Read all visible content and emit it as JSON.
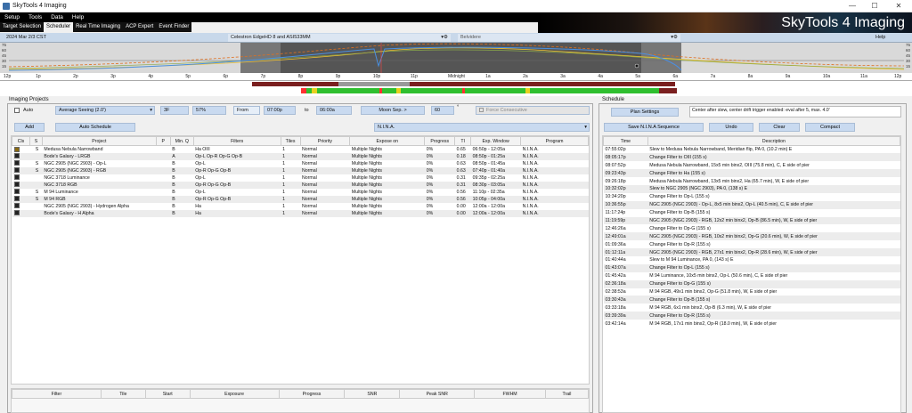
{
  "window": {
    "title": "SkyTools 4 Imaging",
    "minimize": "—",
    "maximize": "☐",
    "close": "✕"
  },
  "menu": [
    "Setup",
    "Tools",
    "Data",
    "Help"
  ],
  "banner": "SkyTools 4 Imaging",
  "tabs": [
    {
      "label": "Target Selection",
      "active": false
    },
    {
      "label": "Scheduler",
      "active": true
    },
    {
      "label": "Real Time Imaging",
      "active": false
    },
    {
      "label": "ACP Expert",
      "active": false
    },
    {
      "label": "Event Finder",
      "active": false
    }
  ],
  "context": {
    "date": "2024 Mar 2/3 CST",
    "scope": "Celestron EdgeHD 8 and ASI533MM",
    "site": "Belvidere",
    "help": "Help"
  },
  "chart": {
    "ylabels": [
      "75",
      "60",
      "45",
      "30",
      "15"
    ],
    "time_labels": [
      "12p",
      "1p",
      "2p",
      "3p",
      "4p",
      "5p",
      "6p",
      "7p",
      "8p",
      "9p",
      "10p",
      "11p",
      "Midnight",
      "1a",
      "2a",
      "3a",
      "4a",
      "5a",
      "6a",
      "7a",
      "8a",
      "9a",
      "10a",
      "11a",
      "12p"
    ]
  },
  "projects_panel": {
    "group_label": "Imaging Projects",
    "auto_label": "Auto",
    "seeing": "Average Seeing (2.0')",
    "pct_a": "3F",
    "pct_b": "57%",
    "from_label": "From",
    "from": "07:00p",
    "to_label": "to",
    "to": "06:00a",
    "moon_label": "Moon Sep. >",
    "moon_sep": "60",
    "deg": "°",
    "force_label": "Force Consecutive",
    "add": "Add",
    "auto_schedule": "Auto Schedule",
    "program": "N.I.N.A.",
    "columns": [
      "Cls",
      "S",
      "Project",
      "P",
      "Min. Q",
      "Filters",
      "Tiles",
      "Priority",
      "Expose on",
      "Progress",
      "TI",
      "Exp. Window",
      "Program"
    ],
    "rows": [
      [
        "S",
        "Medusa Nebula Narrowband",
        "",
        "B",
        "Ha OIII",
        "1",
        "Normal",
        "Multiple Nights",
        "0%",
        "0.65",
        "06:50p - 12:05a",
        "N.I.N.A."
      ],
      [
        "",
        "Bode's Galaxy - LRGB",
        "",
        "A",
        "Op-L Op-R Op-G Op-B",
        "1",
        "Normal",
        "Multiple Nights",
        "0%",
        "0.18",
        "08:50p - 01:25a",
        "N.I.N.A."
      ],
      [
        "S",
        "NGC 2905 (NGC 2903) - Op-L",
        "",
        "B",
        "Op-L",
        "1",
        "Normal",
        "Multiple Nights",
        "0%",
        "0.63",
        "08:50p - 01:45a",
        "N.I.N.A."
      ],
      [
        "S",
        "NGC 2905 (NGC 2903) - RGB",
        "",
        "B",
        "Op-R Op-G Op-B",
        "1",
        "Normal",
        "Multiple Nights",
        "0%",
        "0.63",
        "07:40p - 01:40a",
        "N.I.N.A."
      ],
      [
        "",
        "NGC 3718 Luminance",
        "",
        "B",
        "Op-L",
        "1",
        "Normal",
        "Multiple Nights",
        "0%",
        "0.31",
        "09:35p - 02:25a",
        "N.I.N.A."
      ],
      [
        "",
        "NGC 3718 RGB",
        "",
        "B",
        "Op-R Op-G Op-B",
        "1",
        "Normal",
        "Multiple Nights",
        "0%",
        "0.31",
        "08:30p - 03:05a",
        "N.I.N.A."
      ],
      [
        "S",
        "M 94 Luminance",
        "",
        "B",
        "Op-L",
        "1",
        "Normal",
        "Multiple Nights",
        "0%",
        "0.56",
        "11:10p - 02:35a",
        "N.I.N.A."
      ],
      [
        "S",
        "M 94 RGB",
        "",
        "B",
        "Op-R Op-G Op-B",
        "1",
        "Normal",
        "Multiple Nights",
        "0%",
        "0.56",
        "10:05p - 04:00a",
        "N.I.N.A."
      ],
      [
        "",
        "NGC 2905 (NGC 2903) - Hydrogen Alpha",
        "",
        "B",
        "Ha",
        "1",
        "Normal",
        "Multiple Nights",
        "0%",
        "0.00",
        "12:00a - 12:00a",
        "N.I.N.A."
      ],
      [
        "",
        "Bode's Galaxy - H Alpha",
        "",
        "B",
        "Ha",
        "1",
        "Normal",
        "Multiple Nights",
        "0%",
        "0.00",
        "12:00a - 12:00a",
        "N.I.N.A."
      ]
    ],
    "bottom_columns": [
      "Filter",
      "Tile",
      "Start",
      "Exposure",
      "Progress",
      "SNR",
      "Peak SNR",
      "FWHM",
      "Trail"
    ]
  },
  "schedule": {
    "group_label": "Schedule",
    "plan_settings": "Plan Settings",
    "note": "Center after slew, center drift trigger enabled: eval after 5, max. 4.0'",
    "save": "Save N.I.N.A Sequence",
    "undo": "Undo",
    "clear": "Clear",
    "compact": "Compact",
    "columns": [
      "Time",
      "Description"
    ],
    "rows": [
      [
        "07:55:02p",
        "Slew to Medusa Nebula Narrowband, Meridian flip, PA 0, (10.2 min) E"
      ],
      [
        "08:05:17p",
        "Change Filter to OIII (155 s)"
      ],
      [
        "08:07:52p",
        "Medusa Nebula Narrowband, 15x5 min binx2, OIII (75.8 min), C, E side of pier"
      ],
      [
        "09:23:43p",
        "Change Filter to Ha (155 s)"
      ],
      [
        "09:26:18p",
        "Medusa Nebula Narrowband, 13x5 min binx2, Ha (65.7 min), W, E side of pier"
      ],
      [
        "10:32:02p",
        "Slew to NGC 2905 (NGC 2903), PA 0, (138 s) E"
      ],
      [
        "10:34:20p",
        "Change Filter to Op-L (155 s)"
      ],
      [
        "10:36:55p",
        "NGC 2905 (NGC 2903) - Op-L, 8x5 min binx2, Op-L (40.5 min), C, E side of pier"
      ],
      [
        "11:17:24p",
        "Change Filter to Op-B (155 s)"
      ],
      [
        "11:19:59p",
        "NGC 2905 (NGC 2903) - RGB, 12x2 min binx2, Op-B (86.5 min), W, E side of pier"
      ],
      [
        "12:46:26a",
        "Change Filter to Op-G (155 s)"
      ],
      [
        "12:49:01a",
        "NGC 2905 (NGC 2903) - RGB, 10x2 min binx2, Op-G (20.6 min), W, E side of pier"
      ],
      [
        "01:09:36a",
        "Change Filter to Op-R (155 s)"
      ],
      [
        "01:12:11a",
        "NGC 2905 (NGC 2903) - RGB, 27x1 min binx2, Op-R (28.6 min), W, E side of pier"
      ],
      [
        "01:40:44a",
        "Slew to M 94 Luminance, PA 0, (143 s) E"
      ],
      [
        "01:43:07a",
        "Change Filter to Op-L (155 s)"
      ],
      [
        "01:45:42a",
        "M 94 Luminance, 10x5 min binx2, Op-L (50.6 min), C, E side of pier"
      ],
      [
        "02:36:18a",
        "Change Filter to Op-G (155 s)"
      ],
      [
        "02:38:53a",
        "M 94 RGB, 49x1 min binx2, Op-G (51.8 min), W, E side of pier"
      ],
      [
        "03:30:43a",
        "Change Filter to Op-B (155 s)"
      ],
      [
        "03:33:18a",
        "M 94 RGB, 6x1 min binx2, Op-B (6.3 min), W, E side of pier"
      ],
      [
        "03:39:39a",
        "Change Filter to Op-R (155 s)"
      ],
      [
        "03:42:14a",
        "M 94 RGB, 17x1 min binx2, Op-R (18.0 min), W, E side of pier"
      ]
    ]
  }
}
